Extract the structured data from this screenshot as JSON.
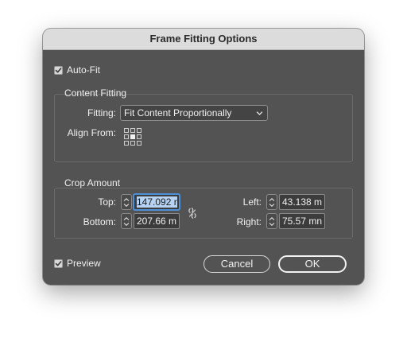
{
  "dialog": {
    "title": "Frame Fitting Options"
  },
  "auto_fit": {
    "label": "Auto-Fit",
    "checked": true
  },
  "content_fitting": {
    "title": "Content Fitting",
    "fitting_label": "Fitting:",
    "fitting_value": "Fit Content Proportionally",
    "align_from_label": "Align From:",
    "align_from_selected": "center"
  },
  "crop_amount": {
    "title": "Crop Amount",
    "top_label": "Top:",
    "top_value": "147.092 r",
    "bottom_label": "Bottom:",
    "bottom_value": "207.66 m",
    "left_label": "Left:",
    "left_value": "43.138 m",
    "right_label": "Right:",
    "right_value": "75.57 mn"
  },
  "preview": {
    "label": "Preview",
    "checked": true
  },
  "buttons": {
    "cancel": "Cancel",
    "ok": "OK"
  },
  "colors": {
    "dialog_bg": "#535353",
    "titlebar_bg": "#dcdcdc",
    "focus": "#4d90d8",
    "selection": "#b7d3f3"
  },
  "icons": {
    "link": "chain-link-icon",
    "stepper": "up-down-arrows-icon",
    "chevron": "chevron-down-icon",
    "check": "checkmark-icon"
  }
}
